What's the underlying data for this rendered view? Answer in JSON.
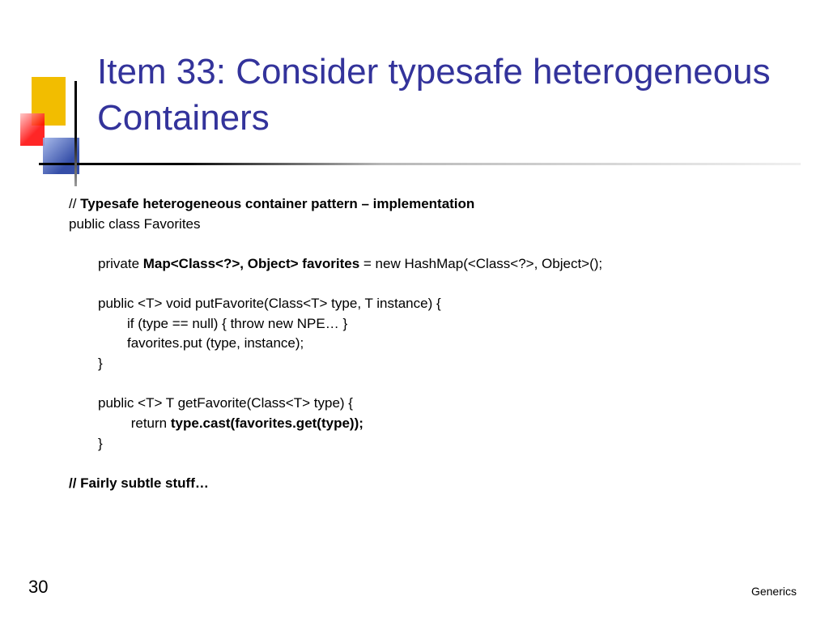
{
  "title": "Item 33: Consider typesafe heterogeneous Containers",
  "code": {
    "l0_a": "// ",
    "l0_b": "Typesafe heterogeneous container pattern – implementation",
    "l1": "public class Favorites",
    "l2_a": "private ",
    "l2_b": "Map<Class<?>, Object> favorites",
    "l2_c": " = new HashMap(<Class<?>, Object>();",
    "l3": "public <T> void putFavorite(Class<T> type, T instance) {",
    "l4": "if (type == null) { throw new NPE… }",
    "l5": "favorites.put (type, instance);",
    "l6": "}",
    "l7": "public <T> T getFavorite(Class<T> type) {",
    "l8_a": " return ",
    "l8_b": "type.cast(favorites.get(type));",
    "l9": "}",
    "l10": "// Fairly subtle stuff…"
  },
  "page_number": "30",
  "footer": "Generics"
}
